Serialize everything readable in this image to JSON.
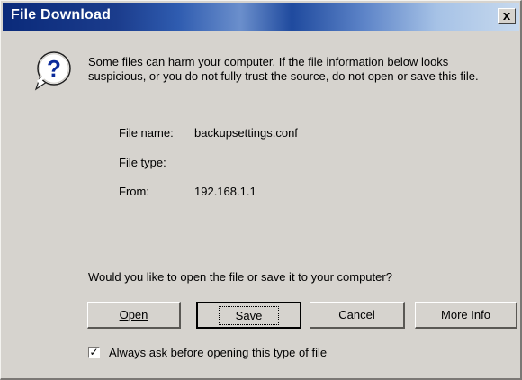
{
  "window": {
    "title": "File Download",
    "close_glyph": "x"
  },
  "message": {
    "icon": "question-icon",
    "text": "Some files can harm your computer. If the file information below looks suspicious, or you do not fully trust the source, do not open or save this file."
  },
  "file_info": {
    "name_label": "File name:",
    "name_value": "backupsettings.conf",
    "type_label": "File type:",
    "type_value": "",
    "from_label": "From:",
    "from_value": "192.168.1.1"
  },
  "prompt": "Would you like to open the file or save it to your computer?",
  "buttons": {
    "open": "Open",
    "save": "Save",
    "cancel": "Cancel",
    "more_info": "More Info"
  },
  "checkbox": {
    "checked": true,
    "label": "Always ask before opening this type of file"
  }
}
